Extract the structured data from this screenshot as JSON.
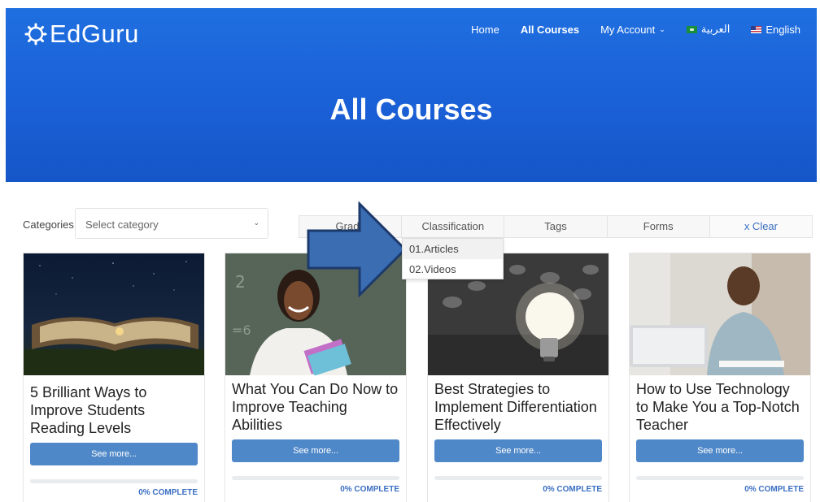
{
  "brand": {
    "name": "EdGuru"
  },
  "nav": {
    "home": "Home",
    "all_courses": "All Courses",
    "my_account": "My Account",
    "arabic": "العربية",
    "english": "English"
  },
  "hero": {
    "title": "All Courses"
  },
  "filters": {
    "categories_label": "Categories",
    "category_placeholder": "Select category",
    "tabs": [
      "Grade",
      "Classification",
      "Tags",
      "Forms"
    ],
    "clear": "x Clear",
    "dropdown_items": [
      "01.Articles",
      "02.Videos"
    ]
  },
  "courses": [
    {
      "title": "5 Brilliant Ways to Improve Students Reading Levels",
      "button": "See more...",
      "progress_percent": 0,
      "status": "0% COMPLETE"
    },
    {
      "title": "What You Can Do Now to Improve Teaching Abilities",
      "button": "See more...",
      "progress_percent": 0,
      "status": "0% COMPLETE"
    },
    {
      "title": "Best Strategies to Implement Differentiation Effectively",
      "button": "See more...",
      "progress_percent": 0,
      "status": "0% COMPLETE"
    },
    {
      "title": "How to Use Technology to Make You a Top-Notch Teacher",
      "button": "See more...",
      "progress_percent": 0,
      "status": "0% COMPLETE"
    }
  ],
  "colors": {
    "hero": "#1a60d6",
    "button": "#4f88c8",
    "link": "#3b6fc2",
    "arrow": "#3b6db3"
  }
}
